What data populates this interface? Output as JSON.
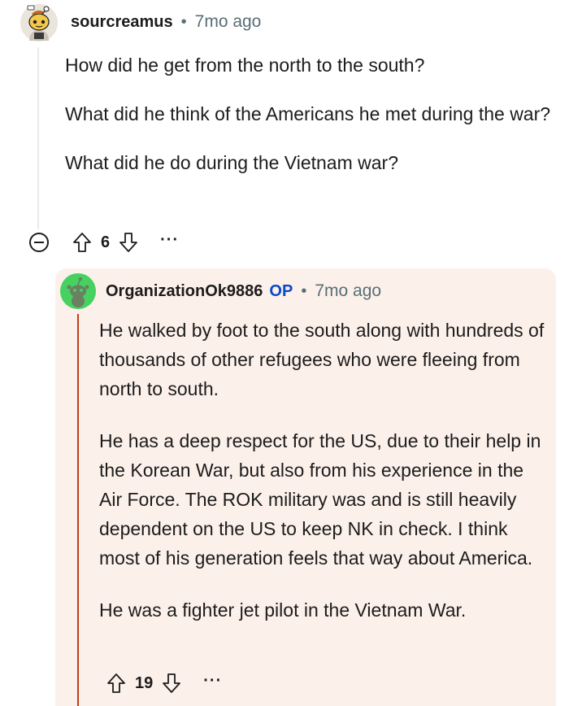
{
  "parent": {
    "username": "sourcreamus",
    "separator": "•",
    "time": "7mo ago",
    "paragraphs": [
      "How did he get from the north to the south?",
      "What did he think of the Americans he met during the war?",
      "What did he do during the Vietnam war?"
    ],
    "score": "6",
    "more": "···"
  },
  "reply": {
    "username": "OrganizationOk9886",
    "op_badge": "OP",
    "separator": "•",
    "time": "7mo ago",
    "paragraphs": [
      "He walked by foot to the south along with hundreds of thousands of other refugees who were fleeing from north to south.",
      "He has a deep respect for the US, due to their help in the Korean War, but also from his experience in the Air Force. The ROK military was and is still heavily dependent on the US to keep NK in check. I think most of his generation feels that way about America.",
      "He was a fighter jet pilot in the Vietnam War."
    ],
    "score": "19",
    "more": "···"
  },
  "colors": {
    "op": "#0a49c9",
    "reply_background": "#fcf0ea",
    "reply_thread_line": "#c3401b",
    "meta_text": "#576f76"
  },
  "icons": {
    "collapse": "collapse-icon",
    "upvote": "upvote-icon",
    "downvote": "downvote-icon",
    "more": "more-options-icon"
  }
}
